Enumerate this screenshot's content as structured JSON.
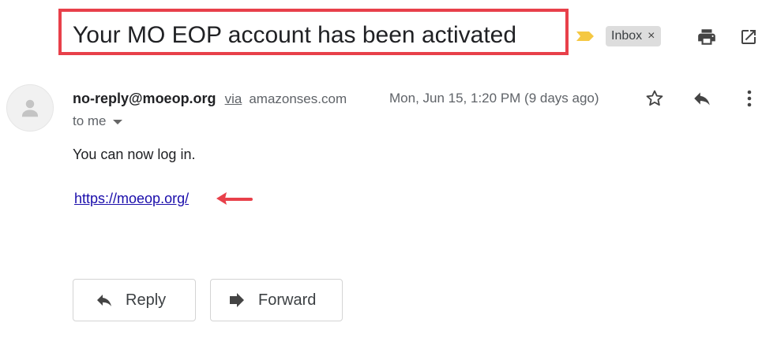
{
  "header": {
    "subject": "Your MO EOP account has been activated",
    "label_chip": "Inbox",
    "label_chip_remove": "×",
    "icons": {
      "importance": "importance-marker-icon",
      "print": "print-icon",
      "open_new_window": "open-in-new-window-icon"
    },
    "colors": {
      "annotation_red": "#e8404a",
      "importance_yellow": "#f5c842"
    }
  },
  "message": {
    "sender_email": "no-reply@moeop.org",
    "via_label": "via",
    "via_domain": "amazonses.com",
    "date": "Mon, Jun 15, 1:20 PM (9 days ago)",
    "recipient": "to me",
    "body_text": "You can now log in.",
    "link_text": "https://moeop.org/",
    "icons": {
      "avatar": "person-icon",
      "star": "star-icon",
      "reply": "reply-icon",
      "more": "more-vertical-icon",
      "recipient_details": "caret-down-icon"
    }
  },
  "actions": {
    "reply_label": "Reply",
    "forward_label": "Forward"
  }
}
